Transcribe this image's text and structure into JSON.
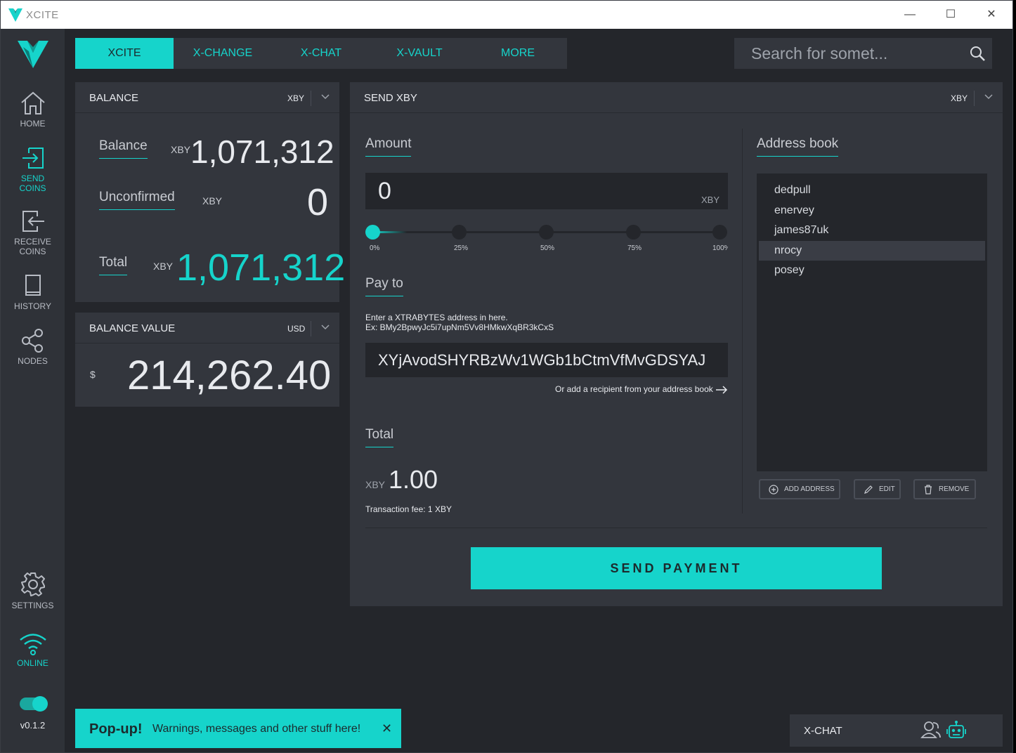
{
  "window": {
    "title": "XCITE",
    "minimize": "—",
    "maximize": "☐",
    "close": "✕"
  },
  "sidebar": {
    "items": [
      {
        "label": "HOME"
      },
      {
        "label": "SEND",
        "label2": "COINS"
      },
      {
        "label": "RECEIVE",
        "label2": "COINS"
      },
      {
        "label": "HISTORY"
      },
      {
        "label": "NODES"
      }
    ],
    "settings": "SETTINGS",
    "online": "ONLINE",
    "version": "v0.1.2"
  },
  "topnav": {
    "tabs": [
      "XCITE",
      "X-CHANGE",
      "X-CHAT",
      "X-VAULT",
      "MORE"
    ]
  },
  "search": {
    "placeholder": "Search for somet..."
  },
  "balance": {
    "title": "BALANCE",
    "currency": "XBY",
    "balance_label": "Balance",
    "balance_unit": "XBY",
    "balance_value": "1,071,312",
    "unconfirmed_label": "Unconfirmed",
    "unconfirmed_unit": "XBY",
    "unconfirmed_value": "0",
    "total_label": "Total",
    "total_unit": "XBY",
    "total_value": "1,071,312"
  },
  "balance_value": {
    "title": "BALANCE VALUE",
    "currency": "USD",
    "symbol": "$",
    "value": "214,262.40"
  },
  "send": {
    "title": "SEND XBY",
    "currency": "XBY",
    "amount_label": "Amount",
    "amount_value": "0",
    "amount_unit": "XBY",
    "slider_labels": [
      "0%",
      "25%",
      "50%",
      "75%",
      "100%"
    ],
    "slider_value": 0,
    "payto_label": "Pay to",
    "hint_line1": "Enter a XTRABYTES address in here.",
    "hint_line2": "Ex: BMy2BpwyJc5i7upNm5Vv8HMkwXqBR3kCxS",
    "address_value": "XYjAvodSHYRBzWv1WGb1bCtmVfMvGDSYAJ",
    "book_link": "Or add a recipient from your address book",
    "total_label": "Total",
    "total_unit": "XBY",
    "total_value": "1.00",
    "fee": "Transaction fee: 1 XBY",
    "send_button": "SEND PAYMENT"
  },
  "address_book": {
    "label": "Address book",
    "entries": [
      "dedpull",
      "enervey",
      "james87uk",
      "nrocy",
      "posey"
    ],
    "selected": "nrocy",
    "add": "ADD ADDRESS",
    "edit": "EDIT",
    "remove": "REMOVE"
  },
  "popup": {
    "title": "Pop-up!",
    "message": "Warnings, messages and other stuff here!",
    "close": "✕"
  },
  "xchat": {
    "title": "X-CHAT"
  },
  "colors": {
    "accent": "#16d4cb",
    "panel": "#33363d",
    "background": "#24262b"
  }
}
